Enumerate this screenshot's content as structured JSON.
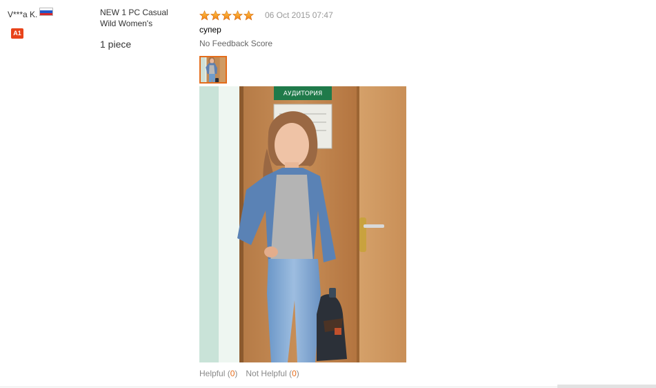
{
  "user": {
    "name": "V***a K.",
    "flag_icon": "russia-flag-icon",
    "level_badge": "A1"
  },
  "product": {
    "title": "NEW 1 PC Casual Wild Women's",
    "quantity": "1 piece"
  },
  "review": {
    "rating": 5,
    "rating_max": 5,
    "star_icon": "star-icon",
    "date": "06 Oct 2015 07:47",
    "text": "супер",
    "feedback_score": "No Feedback Score",
    "photo_count": 1,
    "sign_text": "АУДИТОРИЯ"
  },
  "actions": {
    "helpful_label": "Helpful",
    "helpful_open": " (",
    "helpful_count": "0",
    "helpful_close": ")",
    "not_helpful_label": "Not Helpful",
    "not_helpful_open": " (",
    "not_helpful_count": "0",
    "not_helpful_close": ")"
  },
  "colors": {
    "accent": "#e46c1a",
    "star": "#f7941d",
    "date": "#999999",
    "badge": "#e8431a"
  }
}
